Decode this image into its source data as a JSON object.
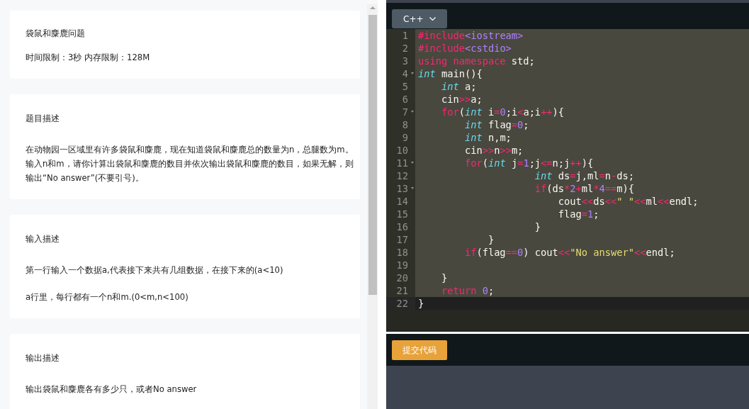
{
  "problem": {
    "title": "袋鼠和麋鹿问题",
    "limits": "时间限制：3秒 内存限制：128M"
  },
  "sections": [
    {
      "heading": "题目描述",
      "paragraphs": [
        "在动物园一区域里有许多袋鼠和麋鹿，现在知道袋鼠和麋鹿总的数量为n，总腿数为m。输入n和m，请你计算出袋鼠和麋鹿的数目并依次输出袋鼠和麋鹿的数目，如果无解，则输出“No answer”(不要引号)。"
      ]
    },
    {
      "heading": "输入描述",
      "paragraphs": [
        "第一行输入一个数据a,代表接下来共有几组数据，在接下来的(a<10)",
        "a行里，每行都有一个n和m.(0<m,n<100)"
      ]
    },
    {
      "heading": "输出描述",
      "paragraphs": [
        "输出袋鼠和麋鹿各有多少只，或者No answer"
      ]
    }
  ],
  "editor": {
    "language": "C++",
    "lines": [
      {
        "number": "1",
        "fold": false,
        "selected": true,
        "tokens": [
          {
            "kind": "kw",
            "text": "#include"
          },
          {
            "kind": "lib",
            "text": "<iostream>"
          }
        ]
      },
      {
        "number": "2",
        "fold": false,
        "selected": true,
        "tokens": [
          {
            "kind": "kw",
            "text": "#include"
          },
          {
            "kind": "lib",
            "text": "<cstdio>"
          }
        ]
      },
      {
        "number": "3",
        "fold": false,
        "selected": true,
        "tokens": [
          {
            "kind": "kw",
            "text": "using namespace"
          },
          {
            "kind": "plain",
            "text": " std;"
          }
        ]
      },
      {
        "number": "4",
        "fold": true,
        "selected": true,
        "tokens": [
          {
            "kind": "type",
            "text": "int"
          },
          {
            "kind": "plain",
            "text": " main(){"
          }
        ]
      },
      {
        "number": "5",
        "fold": false,
        "selected": true,
        "tokens": [
          {
            "kind": "type",
            "text": "    int"
          },
          {
            "kind": "plain",
            "text": " a;"
          }
        ]
      },
      {
        "number": "6",
        "fold": false,
        "selected": true,
        "tokens": [
          {
            "kind": "plain",
            "text": "    cin"
          },
          {
            "kind": "op",
            "text": ">>"
          },
          {
            "kind": "plain",
            "text": "a;"
          }
        ]
      },
      {
        "number": "7",
        "fold": true,
        "selected": true,
        "tokens": [
          {
            "kind": "kw",
            "text": "    for"
          },
          {
            "kind": "plain",
            "text": "("
          },
          {
            "kind": "type",
            "text": "int"
          },
          {
            "kind": "plain",
            "text": " i"
          },
          {
            "kind": "op",
            "text": "="
          },
          {
            "kind": "num",
            "text": "0"
          },
          {
            "kind": "plain",
            "text": ";i"
          },
          {
            "kind": "op",
            "text": "<"
          },
          {
            "kind": "plain",
            "text": "a;i"
          },
          {
            "kind": "op",
            "text": "++"
          },
          {
            "kind": "plain",
            "text": "){"
          }
        ]
      },
      {
        "number": "8",
        "fold": false,
        "selected": true,
        "tokens": [
          {
            "kind": "type",
            "text": "        int"
          },
          {
            "kind": "plain",
            "text": " flag"
          },
          {
            "kind": "op",
            "text": "="
          },
          {
            "kind": "num",
            "text": "0"
          },
          {
            "kind": "plain",
            "text": ";"
          }
        ]
      },
      {
        "number": "9",
        "fold": false,
        "selected": true,
        "tokens": [
          {
            "kind": "type",
            "text": "        int"
          },
          {
            "kind": "plain",
            "text": " n,m;"
          }
        ]
      },
      {
        "number": "10",
        "fold": false,
        "selected": true,
        "tokens": [
          {
            "kind": "plain",
            "text": "        cin"
          },
          {
            "kind": "op",
            "text": ">>"
          },
          {
            "kind": "plain",
            "text": "n"
          },
          {
            "kind": "op",
            "text": ">>"
          },
          {
            "kind": "plain",
            "text": "m;"
          }
        ]
      },
      {
        "number": "11",
        "fold": true,
        "selected": true,
        "tokens": [
          {
            "kind": "kw",
            "text": "        for"
          },
          {
            "kind": "plain",
            "text": "("
          },
          {
            "kind": "type",
            "text": "int"
          },
          {
            "kind": "plain",
            "text": " j"
          },
          {
            "kind": "op",
            "text": "="
          },
          {
            "kind": "num",
            "text": "1"
          },
          {
            "kind": "plain",
            "text": ";j"
          },
          {
            "kind": "op",
            "text": "<="
          },
          {
            "kind": "plain",
            "text": "n;j"
          },
          {
            "kind": "op",
            "text": "++"
          },
          {
            "kind": "plain",
            "text": "){"
          }
        ]
      },
      {
        "number": "12",
        "fold": false,
        "selected": true,
        "tokens": [
          {
            "kind": "type",
            "text": "                    int"
          },
          {
            "kind": "plain",
            "text": " ds"
          },
          {
            "kind": "op",
            "text": "="
          },
          {
            "kind": "plain",
            "text": "j,ml"
          },
          {
            "kind": "op",
            "text": "="
          },
          {
            "kind": "plain",
            "text": "n"
          },
          {
            "kind": "op",
            "text": "-"
          },
          {
            "kind": "plain",
            "text": "ds;"
          }
        ]
      },
      {
        "number": "13",
        "fold": true,
        "selected": true,
        "tokens": [
          {
            "kind": "kw",
            "text": "                    if"
          },
          {
            "kind": "plain",
            "text": "(ds"
          },
          {
            "kind": "op",
            "text": "*"
          },
          {
            "kind": "num",
            "text": "2"
          },
          {
            "kind": "op",
            "text": "+"
          },
          {
            "kind": "plain",
            "text": "ml"
          },
          {
            "kind": "op",
            "text": "*"
          },
          {
            "kind": "num",
            "text": "4"
          },
          {
            "kind": "op",
            "text": "=="
          },
          {
            "kind": "plain",
            "text": "m){"
          }
        ]
      },
      {
        "number": "14",
        "fold": false,
        "selected": true,
        "tokens": [
          {
            "kind": "plain",
            "text": "                        cout"
          },
          {
            "kind": "op",
            "text": "<<"
          },
          {
            "kind": "plain",
            "text": "ds"
          },
          {
            "kind": "op",
            "text": "<<"
          },
          {
            "kind": "str",
            "text": "\" \""
          },
          {
            "kind": "op",
            "text": "<<"
          },
          {
            "kind": "plain",
            "text": "ml"
          },
          {
            "kind": "op",
            "text": "<<"
          },
          {
            "kind": "plain",
            "text": "endl;"
          }
        ]
      },
      {
        "number": "15",
        "fold": false,
        "selected": true,
        "tokens": [
          {
            "kind": "plain",
            "text": "                        flag"
          },
          {
            "kind": "op",
            "text": "="
          },
          {
            "kind": "num",
            "text": "1"
          },
          {
            "kind": "plain",
            "text": ";"
          }
        ]
      },
      {
        "number": "16",
        "fold": false,
        "selected": true,
        "tokens": [
          {
            "kind": "plain",
            "text": "                    }"
          }
        ]
      },
      {
        "number": "17",
        "fold": false,
        "selected": true,
        "tokens": [
          {
            "kind": "plain",
            "text": "            }"
          }
        ]
      },
      {
        "number": "18",
        "fold": false,
        "selected": true,
        "tokens": [
          {
            "kind": "kw",
            "text": "        if"
          },
          {
            "kind": "plain",
            "text": "(flag"
          },
          {
            "kind": "op",
            "text": "=="
          },
          {
            "kind": "num",
            "text": "0"
          },
          {
            "kind": "plain",
            "text": ") cout"
          },
          {
            "kind": "op",
            "text": "<<"
          },
          {
            "kind": "str",
            "text": "\"No answer\""
          },
          {
            "kind": "op",
            "text": "<<"
          },
          {
            "kind": "plain",
            "text": "endl;"
          }
        ]
      },
      {
        "number": "19",
        "fold": false,
        "selected": true
      },
      {
        "number": "20",
        "fold": false,
        "selected": true,
        "tokens": [
          {
            "kind": "plain",
            "text": "    }"
          }
        ]
      },
      {
        "number": "21",
        "fold": false,
        "selected": true,
        "tokens": [
          {
            "kind": "kw",
            "text": "    return"
          },
          {
            "kind": "num",
            "text": " 0"
          },
          {
            "kind": "plain",
            "text": ";"
          }
        ]
      },
      {
        "number": "22",
        "fold": false,
        "selected": false,
        "tokens": [
          {
            "kind": "plain",
            "text": "}"
          }
        ]
      }
    ]
  },
  "submit_button": "提交代码"
}
